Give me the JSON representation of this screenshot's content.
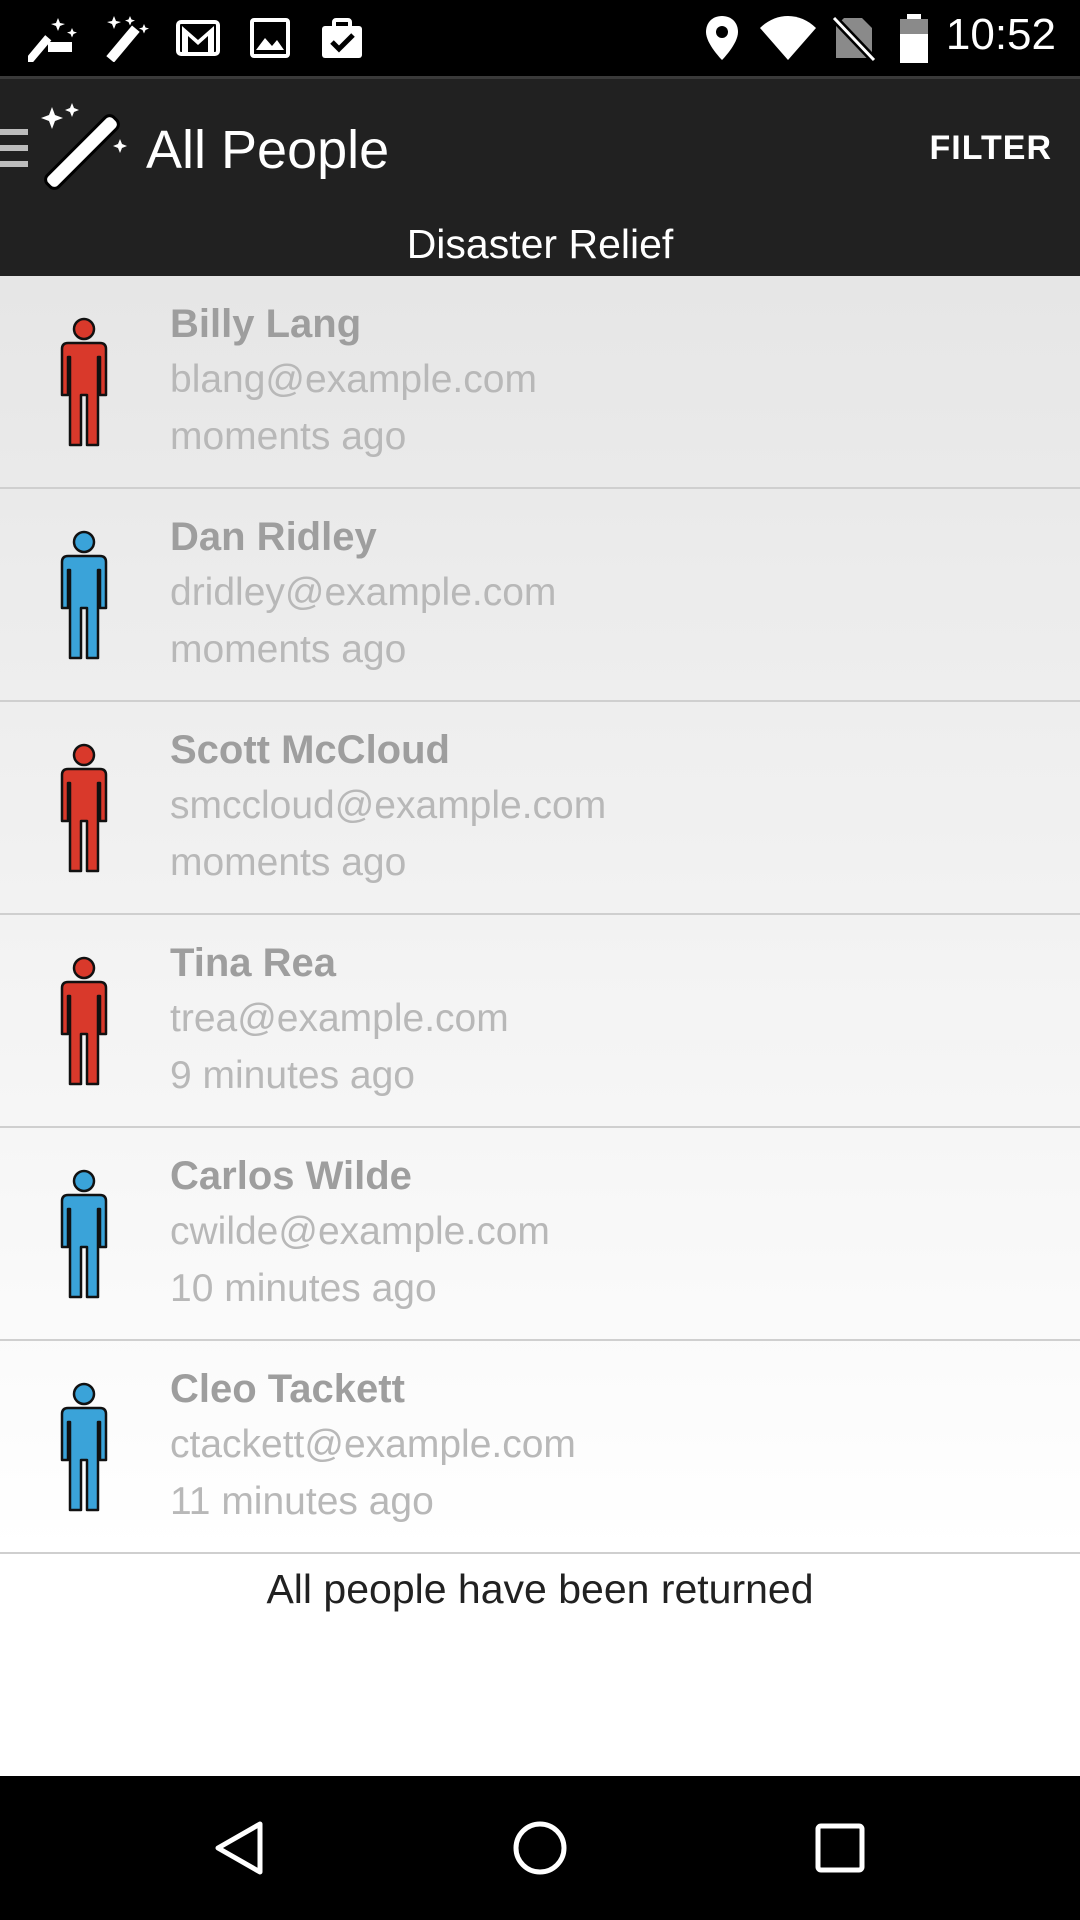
{
  "status_bar": {
    "time": "10:52",
    "icons": [
      "magic-wand-notification-icon",
      "magic-wand-notification-icon",
      "gmail-icon",
      "image-icon",
      "clipboard-check-icon",
      "location-icon",
      "wifi-icon",
      "no-sim-icon",
      "battery-icon"
    ]
  },
  "action_bar": {
    "title": "All People",
    "filter_label": "FILTER",
    "icons": [
      "menu-icon",
      "magic-wand-logo-icon"
    ]
  },
  "subtitle": "Disaster Relief",
  "people": [
    {
      "name": "Billy Lang",
      "email": "blang@example.com",
      "time": "moments ago",
      "icon": "person-icon",
      "icon_color": "#d9392b"
    },
    {
      "name": "Dan Ridley",
      "email": "dridley@example.com",
      "time": "moments ago",
      "icon": "person-icon",
      "icon_color": "#3aa3d9"
    },
    {
      "name": "Scott McCloud",
      "email": "smccloud@example.com",
      "time": "moments ago",
      "icon": "person-icon",
      "icon_color": "#d9392b"
    },
    {
      "name": "Tina Rea",
      "email": "trea@example.com",
      "time": "9 minutes ago",
      "icon": "person-icon",
      "icon_color": "#d9392b"
    },
    {
      "name": "Carlos Wilde",
      "email": "cwilde@example.com",
      "time": "10 minutes ago",
      "icon": "person-icon",
      "icon_color": "#3aa3d9"
    },
    {
      "name": "Cleo Tackett",
      "email": "ctackett@example.com",
      "time": "11 minutes ago",
      "icon": "person-icon",
      "icon_color": "#3aa3d9"
    }
  ],
  "footer_message": "All people have been returned",
  "nav_bar": {
    "icons": [
      "back-icon",
      "home-icon",
      "recents-icon"
    ]
  },
  "colors": {
    "toolbar": "#212121",
    "red": "#d9392b",
    "blue": "#3aa3d9"
  }
}
